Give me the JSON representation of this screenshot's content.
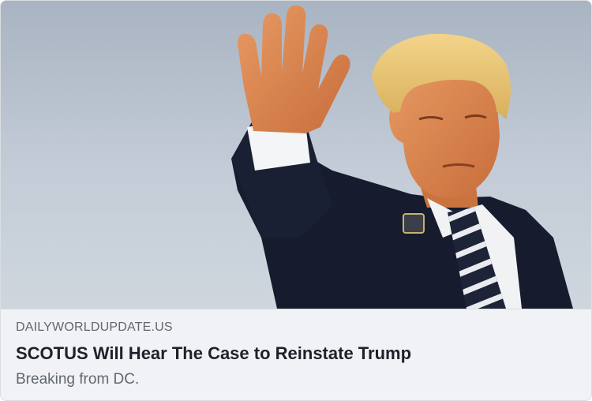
{
  "link_preview": {
    "image_alt_icon": "photo-hero-image",
    "domain": "DAILYWORLDUPDATE.US",
    "headline": "SCOTUS Will Hear The Case to Reinstate Trump",
    "subtitle": "Breaking from DC."
  },
  "colors": {
    "sky": "#b9c3cf",
    "suit": "#1a2033",
    "meta_background": "#f0f2f5",
    "headline_text": "#1d2129",
    "secondary_text": "#606770"
  }
}
